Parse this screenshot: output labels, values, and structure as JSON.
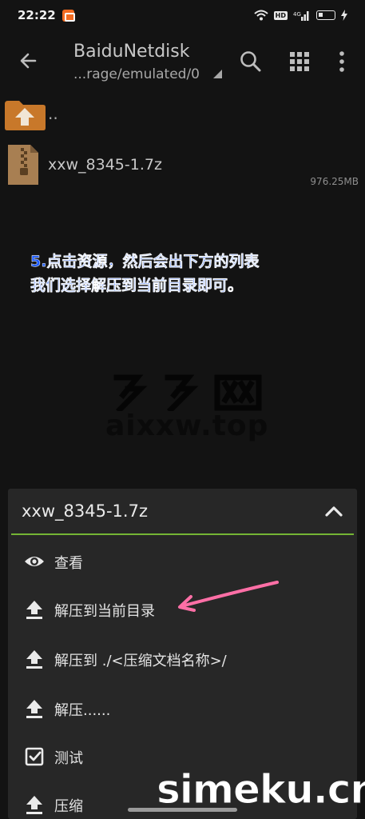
{
  "status_bar": {
    "time": "22:22",
    "hd_badge": "HD",
    "network": "4G"
  },
  "app_bar": {
    "title": "BaiduNetdisk",
    "path": "...rage/emulated/0"
  },
  "files": [
    {
      "name": "..",
      "type": "parent-folder"
    },
    {
      "name": "xxw_8345-1.7z",
      "size": "976.25MB",
      "type": "archive"
    }
  ],
  "annotation": {
    "line1": "5.点击资源，然后会出下方的列表",
    "line2": "我们选择解压到当前目录即可。"
  },
  "watermark": {
    "domain": "aixxw.top",
    "bottom": "simeku.cn"
  },
  "sheet": {
    "title": "xxw_8345-1.7z",
    "items": [
      {
        "label": "查看",
        "icon": "eye-icon"
      },
      {
        "label": "解压到当前目录",
        "icon": "upload-icon"
      },
      {
        "label": "解压到 ./<压缩文档名称>/",
        "icon": "upload-icon"
      },
      {
        "label": "解压......",
        "icon": "upload-icon"
      },
      {
        "label": "测试",
        "icon": "checkbox-icon"
      },
      {
        "label": "压缩",
        "icon": "upload-icon"
      }
    ]
  },
  "colors": {
    "accent_green": "#74b534",
    "annotation_blue": "#1d5bff",
    "arrow_pink": "#ff6fa6",
    "folder_orange": "#c8782a"
  }
}
